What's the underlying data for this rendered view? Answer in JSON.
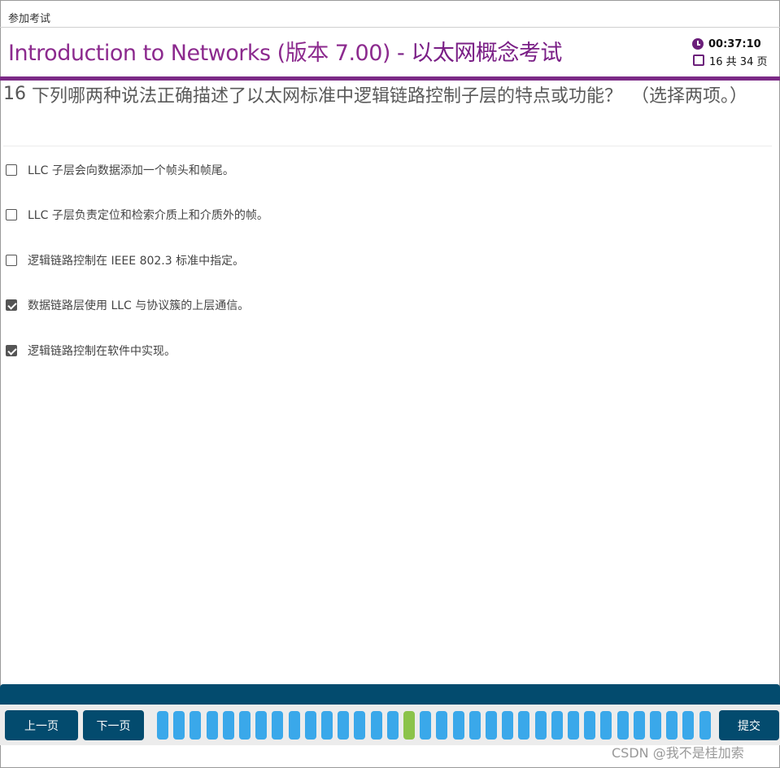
{
  "top_label": "参加考试",
  "header": {
    "course": "Introduction to Networks (版本 7.00)",
    "separator": " - ",
    "exam": "以太网概念考试",
    "timer": "00:37:10",
    "page_status": "16 共 34 页"
  },
  "question": {
    "number": "16",
    "text": "下列哪两种说法正确描述了以太网标准中逻辑链路控制子层的特点或功能？　（选择两项。）"
  },
  "options": [
    {
      "label": "LLC 子层会向数据添加一个帧头和帧尾。",
      "checked": false
    },
    {
      "label": "LLC 子层负责定位和检索介质上和介质外的帧。",
      "checked": false
    },
    {
      "label": "逻辑链路控制在 IEEE 802.3 标准中指定。",
      "checked": false
    },
    {
      "label": "数据链路层使用 LLC 与协议簇的上层通信。",
      "checked": true
    },
    {
      "label": "逻辑链路控制在软件中实现。",
      "checked": true
    }
  ],
  "navigation": {
    "prev_label": "上一页",
    "next_label": "下一页",
    "submit_label": "提交",
    "total_pages": 34,
    "current_page": 16
  },
  "colors": {
    "accent_purple": "#7b2a86",
    "nav_blue": "#034b6e",
    "page_blue": "#3aa8ea",
    "page_current": "#8bc34a"
  },
  "watermark": "CSDN @我不是桂加索"
}
